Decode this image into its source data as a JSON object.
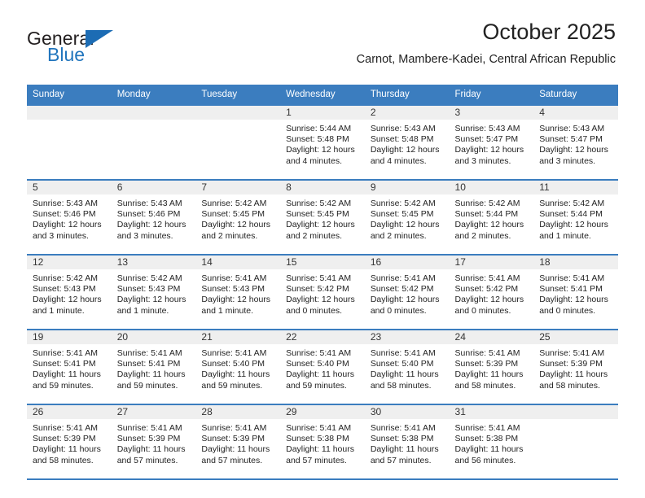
{
  "brand": {
    "name_top": "General",
    "name_bottom": "Blue",
    "accent_color": "#2175bd",
    "triangle_icon": "triangle-icon"
  },
  "header": {
    "title": "October 2025",
    "subtitle": "Carnot, Mambere-Kadei, Central African Republic"
  },
  "calendar": {
    "header_bg": "#3b7dbf",
    "daynum_bg": "#efefef",
    "weekdays": [
      "Sunday",
      "Monday",
      "Tuesday",
      "Wednesday",
      "Thursday",
      "Friday",
      "Saturday"
    ],
    "weeks": [
      [
        {
          "day": "",
          "lines": []
        },
        {
          "day": "",
          "lines": []
        },
        {
          "day": "",
          "lines": []
        },
        {
          "day": "1",
          "lines": [
            "Sunrise: 5:44 AM",
            "Sunset: 5:48 PM",
            "Daylight: 12 hours",
            "and 4 minutes."
          ]
        },
        {
          "day": "2",
          "lines": [
            "Sunrise: 5:43 AM",
            "Sunset: 5:48 PM",
            "Daylight: 12 hours",
            "and 4 minutes."
          ]
        },
        {
          "day": "3",
          "lines": [
            "Sunrise: 5:43 AM",
            "Sunset: 5:47 PM",
            "Daylight: 12 hours",
            "and 3 minutes."
          ]
        },
        {
          "day": "4",
          "lines": [
            "Sunrise: 5:43 AM",
            "Sunset: 5:47 PM",
            "Daylight: 12 hours",
            "and 3 minutes."
          ]
        }
      ],
      [
        {
          "day": "5",
          "lines": [
            "Sunrise: 5:43 AM",
            "Sunset: 5:46 PM",
            "Daylight: 12 hours",
            "and 3 minutes."
          ]
        },
        {
          "day": "6",
          "lines": [
            "Sunrise: 5:43 AM",
            "Sunset: 5:46 PM",
            "Daylight: 12 hours",
            "and 3 minutes."
          ]
        },
        {
          "day": "7",
          "lines": [
            "Sunrise: 5:42 AM",
            "Sunset: 5:45 PM",
            "Daylight: 12 hours",
            "and 2 minutes."
          ]
        },
        {
          "day": "8",
          "lines": [
            "Sunrise: 5:42 AM",
            "Sunset: 5:45 PM",
            "Daylight: 12 hours",
            "and 2 minutes."
          ]
        },
        {
          "day": "9",
          "lines": [
            "Sunrise: 5:42 AM",
            "Sunset: 5:45 PM",
            "Daylight: 12 hours",
            "and 2 minutes."
          ]
        },
        {
          "day": "10",
          "lines": [
            "Sunrise: 5:42 AM",
            "Sunset: 5:44 PM",
            "Daylight: 12 hours",
            "and 2 minutes."
          ]
        },
        {
          "day": "11",
          "lines": [
            "Sunrise: 5:42 AM",
            "Sunset: 5:44 PM",
            "Daylight: 12 hours",
            "and 1 minute."
          ]
        }
      ],
      [
        {
          "day": "12",
          "lines": [
            "Sunrise: 5:42 AM",
            "Sunset: 5:43 PM",
            "Daylight: 12 hours",
            "and 1 minute."
          ]
        },
        {
          "day": "13",
          "lines": [
            "Sunrise: 5:42 AM",
            "Sunset: 5:43 PM",
            "Daylight: 12 hours",
            "and 1 minute."
          ]
        },
        {
          "day": "14",
          "lines": [
            "Sunrise: 5:41 AM",
            "Sunset: 5:43 PM",
            "Daylight: 12 hours",
            "and 1 minute."
          ]
        },
        {
          "day": "15",
          "lines": [
            "Sunrise: 5:41 AM",
            "Sunset: 5:42 PM",
            "Daylight: 12 hours",
            "and 0 minutes."
          ]
        },
        {
          "day": "16",
          "lines": [
            "Sunrise: 5:41 AM",
            "Sunset: 5:42 PM",
            "Daylight: 12 hours",
            "and 0 minutes."
          ]
        },
        {
          "day": "17",
          "lines": [
            "Sunrise: 5:41 AM",
            "Sunset: 5:42 PM",
            "Daylight: 12 hours",
            "and 0 minutes."
          ]
        },
        {
          "day": "18",
          "lines": [
            "Sunrise: 5:41 AM",
            "Sunset: 5:41 PM",
            "Daylight: 12 hours",
            "and 0 minutes."
          ]
        }
      ],
      [
        {
          "day": "19",
          "lines": [
            "Sunrise: 5:41 AM",
            "Sunset: 5:41 PM",
            "Daylight: 11 hours",
            "and 59 minutes."
          ]
        },
        {
          "day": "20",
          "lines": [
            "Sunrise: 5:41 AM",
            "Sunset: 5:41 PM",
            "Daylight: 11 hours",
            "and 59 minutes."
          ]
        },
        {
          "day": "21",
          "lines": [
            "Sunrise: 5:41 AM",
            "Sunset: 5:40 PM",
            "Daylight: 11 hours",
            "and 59 minutes."
          ]
        },
        {
          "day": "22",
          "lines": [
            "Sunrise: 5:41 AM",
            "Sunset: 5:40 PM",
            "Daylight: 11 hours",
            "and 59 minutes."
          ]
        },
        {
          "day": "23",
          "lines": [
            "Sunrise: 5:41 AM",
            "Sunset: 5:40 PM",
            "Daylight: 11 hours",
            "and 58 minutes."
          ]
        },
        {
          "day": "24",
          "lines": [
            "Sunrise: 5:41 AM",
            "Sunset: 5:39 PM",
            "Daylight: 11 hours",
            "and 58 minutes."
          ]
        },
        {
          "day": "25",
          "lines": [
            "Sunrise: 5:41 AM",
            "Sunset: 5:39 PM",
            "Daylight: 11 hours",
            "and 58 minutes."
          ]
        }
      ],
      [
        {
          "day": "26",
          "lines": [
            "Sunrise: 5:41 AM",
            "Sunset: 5:39 PM",
            "Daylight: 11 hours",
            "and 58 minutes."
          ]
        },
        {
          "day": "27",
          "lines": [
            "Sunrise: 5:41 AM",
            "Sunset: 5:39 PM",
            "Daylight: 11 hours",
            "and 57 minutes."
          ]
        },
        {
          "day": "28",
          "lines": [
            "Sunrise: 5:41 AM",
            "Sunset: 5:39 PM",
            "Daylight: 11 hours",
            "and 57 minutes."
          ]
        },
        {
          "day": "29",
          "lines": [
            "Sunrise: 5:41 AM",
            "Sunset: 5:38 PM",
            "Daylight: 11 hours",
            "and 57 minutes."
          ]
        },
        {
          "day": "30",
          "lines": [
            "Sunrise: 5:41 AM",
            "Sunset: 5:38 PM",
            "Daylight: 11 hours",
            "and 57 minutes."
          ]
        },
        {
          "day": "31",
          "lines": [
            "Sunrise: 5:41 AM",
            "Sunset: 5:38 PM",
            "Daylight: 11 hours",
            "and 56 minutes."
          ]
        },
        {
          "day": "",
          "lines": []
        }
      ]
    ]
  }
}
